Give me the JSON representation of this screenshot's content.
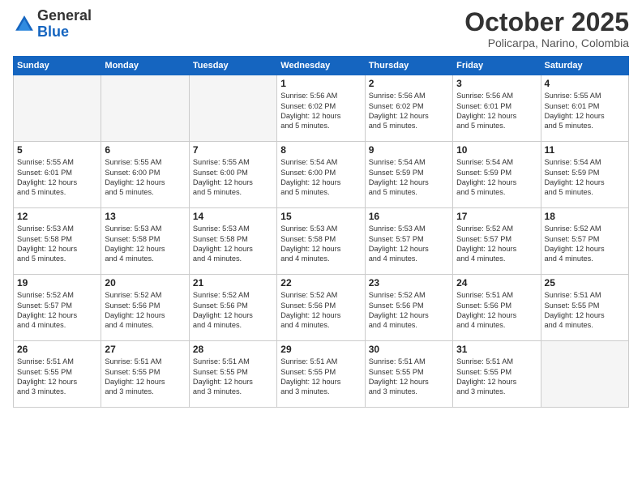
{
  "header": {
    "logo_general": "General",
    "logo_blue": "Blue",
    "month_title": "October 2025",
    "subtitle": "Policarpa, Narino, Colombia"
  },
  "weekdays": [
    "Sunday",
    "Monday",
    "Tuesday",
    "Wednesday",
    "Thursday",
    "Friday",
    "Saturday"
  ],
  "weeks": [
    [
      {
        "day": "",
        "info": ""
      },
      {
        "day": "",
        "info": ""
      },
      {
        "day": "",
        "info": ""
      },
      {
        "day": "1",
        "info": "Sunrise: 5:56 AM\nSunset: 6:02 PM\nDaylight: 12 hours\nand 5 minutes."
      },
      {
        "day": "2",
        "info": "Sunrise: 5:56 AM\nSunset: 6:02 PM\nDaylight: 12 hours\nand 5 minutes."
      },
      {
        "day": "3",
        "info": "Sunrise: 5:56 AM\nSunset: 6:01 PM\nDaylight: 12 hours\nand 5 minutes."
      },
      {
        "day": "4",
        "info": "Sunrise: 5:55 AM\nSunset: 6:01 PM\nDaylight: 12 hours\nand 5 minutes."
      }
    ],
    [
      {
        "day": "5",
        "info": "Sunrise: 5:55 AM\nSunset: 6:01 PM\nDaylight: 12 hours\nand 5 minutes."
      },
      {
        "day": "6",
        "info": "Sunrise: 5:55 AM\nSunset: 6:00 PM\nDaylight: 12 hours\nand 5 minutes."
      },
      {
        "day": "7",
        "info": "Sunrise: 5:55 AM\nSunset: 6:00 PM\nDaylight: 12 hours\nand 5 minutes."
      },
      {
        "day": "8",
        "info": "Sunrise: 5:54 AM\nSunset: 6:00 PM\nDaylight: 12 hours\nand 5 minutes."
      },
      {
        "day": "9",
        "info": "Sunrise: 5:54 AM\nSunset: 5:59 PM\nDaylight: 12 hours\nand 5 minutes."
      },
      {
        "day": "10",
        "info": "Sunrise: 5:54 AM\nSunset: 5:59 PM\nDaylight: 12 hours\nand 5 minutes."
      },
      {
        "day": "11",
        "info": "Sunrise: 5:54 AM\nSunset: 5:59 PM\nDaylight: 12 hours\nand 5 minutes."
      }
    ],
    [
      {
        "day": "12",
        "info": "Sunrise: 5:53 AM\nSunset: 5:58 PM\nDaylight: 12 hours\nand 5 minutes."
      },
      {
        "day": "13",
        "info": "Sunrise: 5:53 AM\nSunset: 5:58 PM\nDaylight: 12 hours\nand 4 minutes."
      },
      {
        "day": "14",
        "info": "Sunrise: 5:53 AM\nSunset: 5:58 PM\nDaylight: 12 hours\nand 4 minutes."
      },
      {
        "day": "15",
        "info": "Sunrise: 5:53 AM\nSunset: 5:58 PM\nDaylight: 12 hours\nand 4 minutes."
      },
      {
        "day": "16",
        "info": "Sunrise: 5:53 AM\nSunset: 5:57 PM\nDaylight: 12 hours\nand 4 minutes."
      },
      {
        "day": "17",
        "info": "Sunrise: 5:52 AM\nSunset: 5:57 PM\nDaylight: 12 hours\nand 4 minutes."
      },
      {
        "day": "18",
        "info": "Sunrise: 5:52 AM\nSunset: 5:57 PM\nDaylight: 12 hours\nand 4 minutes."
      }
    ],
    [
      {
        "day": "19",
        "info": "Sunrise: 5:52 AM\nSunset: 5:57 PM\nDaylight: 12 hours\nand 4 minutes."
      },
      {
        "day": "20",
        "info": "Sunrise: 5:52 AM\nSunset: 5:56 PM\nDaylight: 12 hours\nand 4 minutes."
      },
      {
        "day": "21",
        "info": "Sunrise: 5:52 AM\nSunset: 5:56 PM\nDaylight: 12 hours\nand 4 minutes."
      },
      {
        "day": "22",
        "info": "Sunrise: 5:52 AM\nSunset: 5:56 PM\nDaylight: 12 hours\nand 4 minutes."
      },
      {
        "day": "23",
        "info": "Sunrise: 5:52 AM\nSunset: 5:56 PM\nDaylight: 12 hours\nand 4 minutes."
      },
      {
        "day": "24",
        "info": "Sunrise: 5:51 AM\nSunset: 5:56 PM\nDaylight: 12 hours\nand 4 minutes."
      },
      {
        "day": "25",
        "info": "Sunrise: 5:51 AM\nSunset: 5:55 PM\nDaylight: 12 hours\nand 4 minutes."
      }
    ],
    [
      {
        "day": "26",
        "info": "Sunrise: 5:51 AM\nSunset: 5:55 PM\nDaylight: 12 hours\nand 3 minutes."
      },
      {
        "day": "27",
        "info": "Sunrise: 5:51 AM\nSunset: 5:55 PM\nDaylight: 12 hours\nand 3 minutes."
      },
      {
        "day": "28",
        "info": "Sunrise: 5:51 AM\nSunset: 5:55 PM\nDaylight: 12 hours\nand 3 minutes."
      },
      {
        "day": "29",
        "info": "Sunrise: 5:51 AM\nSunset: 5:55 PM\nDaylight: 12 hours\nand 3 minutes."
      },
      {
        "day": "30",
        "info": "Sunrise: 5:51 AM\nSunset: 5:55 PM\nDaylight: 12 hours\nand 3 minutes."
      },
      {
        "day": "31",
        "info": "Sunrise: 5:51 AM\nSunset: 5:55 PM\nDaylight: 12 hours\nand 3 minutes."
      },
      {
        "day": "",
        "info": ""
      }
    ]
  ]
}
